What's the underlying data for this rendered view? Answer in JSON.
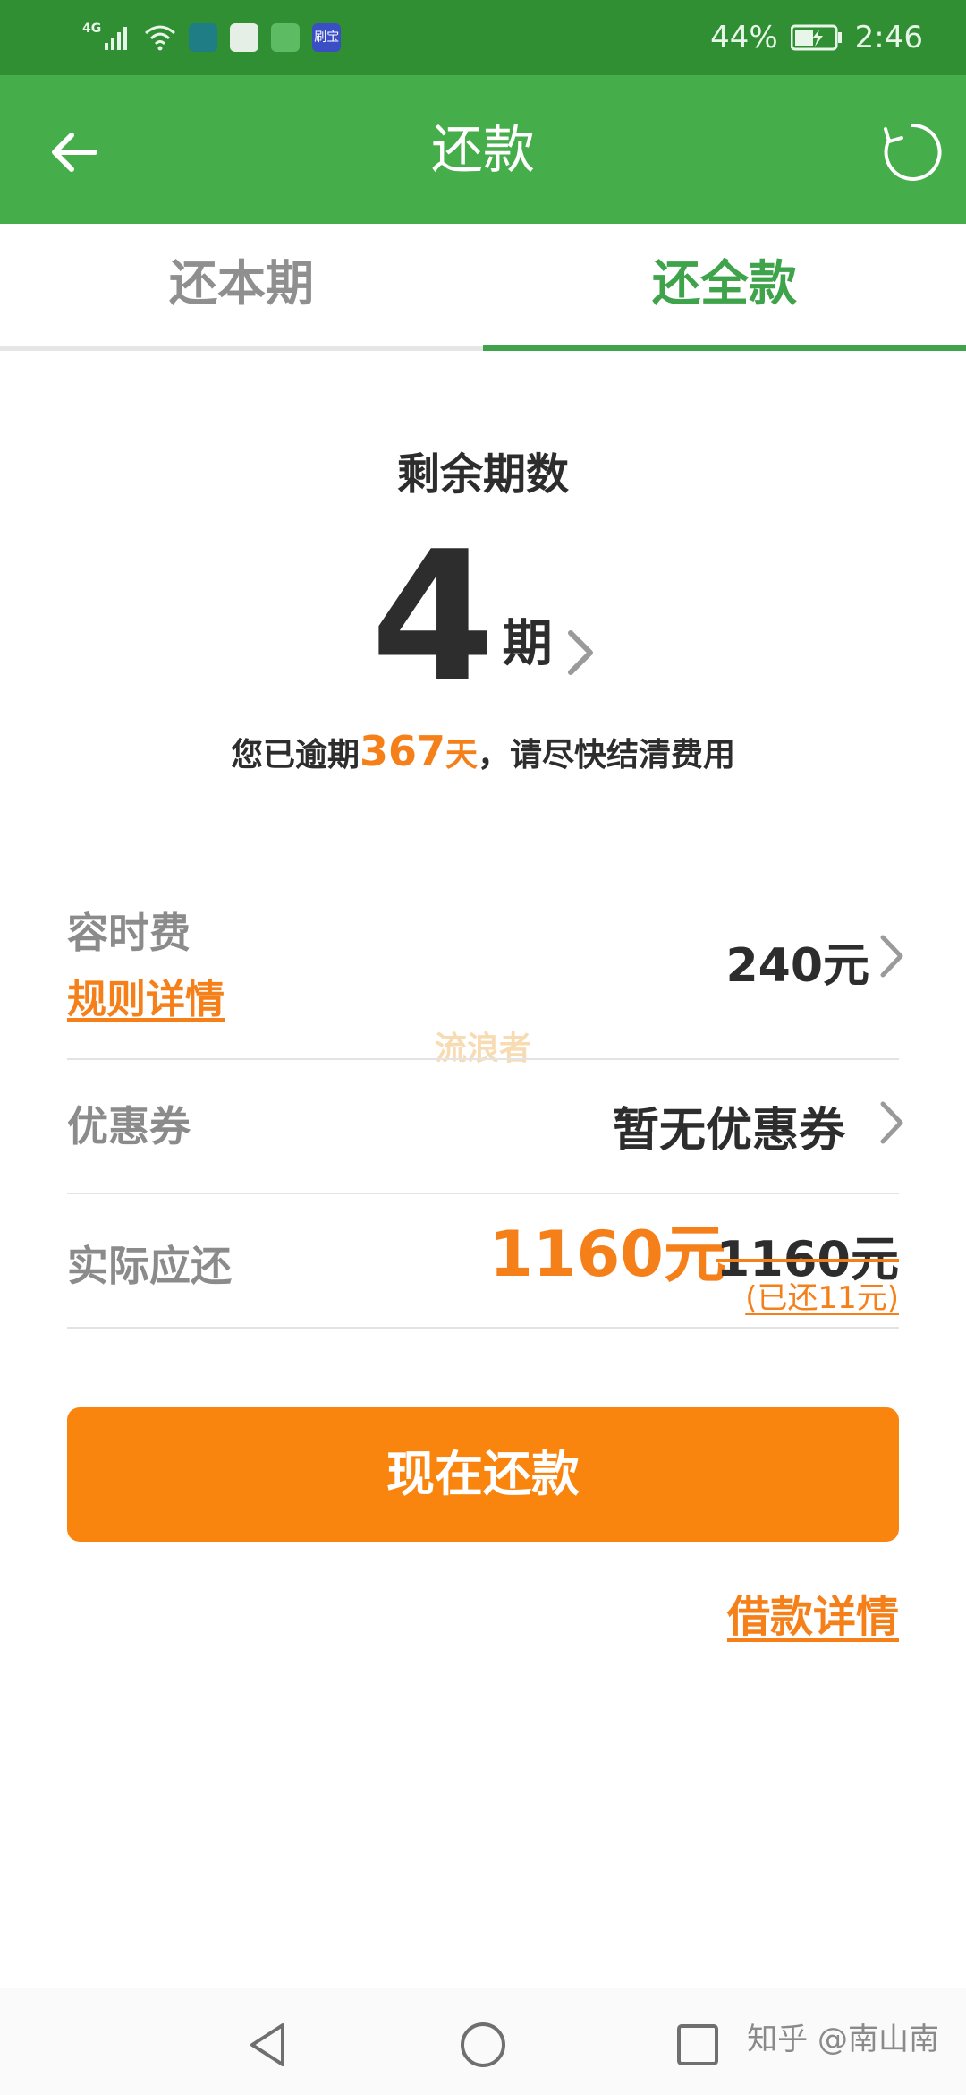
{
  "status_bar": {
    "network_label": "4G",
    "app_badge": "刷宝",
    "battery": "44%",
    "time": "2:46",
    "icons": [
      "signal-icon",
      "wifi-icon",
      "notification-icon",
      "huawei-icon",
      "wechat-icon",
      "shuabao-icon",
      "battery-icon"
    ]
  },
  "app_bar": {
    "title": "还款"
  },
  "tabs": [
    {
      "label": "还本期",
      "active": false
    },
    {
      "label": "还全款",
      "active": true
    }
  ],
  "summary": {
    "remaining_label": "剩余期数",
    "periods_value": "4",
    "periods_unit": "期",
    "overdue_prefix": "您已逾期",
    "overdue_days": "367",
    "overdue_days_unit": "天",
    "overdue_suffix": "，请尽快结清费用"
  },
  "rows": {
    "fee": {
      "label": "容时费",
      "link": "规则详情",
      "value": "240元"
    },
    "coupon": {
      "label": "优惠券",
      "value": "暂无优惠券"
    },
    "actual": {
      "label": "实际应还",
      "amount": "1160元",
      "original": "1160元",
      "paid_note": "(已还11元)"
    }
  },
  "watermark": "流浪者",
  "pay_button": "现在还款",
  "loan_details_link": "借款详情",
  "nav_watermark": "知乎 @南山南",
  "colors": {
    "status_bar": "#2f8f32",
    "app_bar": "#45ad4a",
    "accent_green": "#3ea34a",
    "accent_orange": "#f9850f",
    "text_dark": "#2d2d2d",
    "text_gray": "#8b8b8b"
  }
}
